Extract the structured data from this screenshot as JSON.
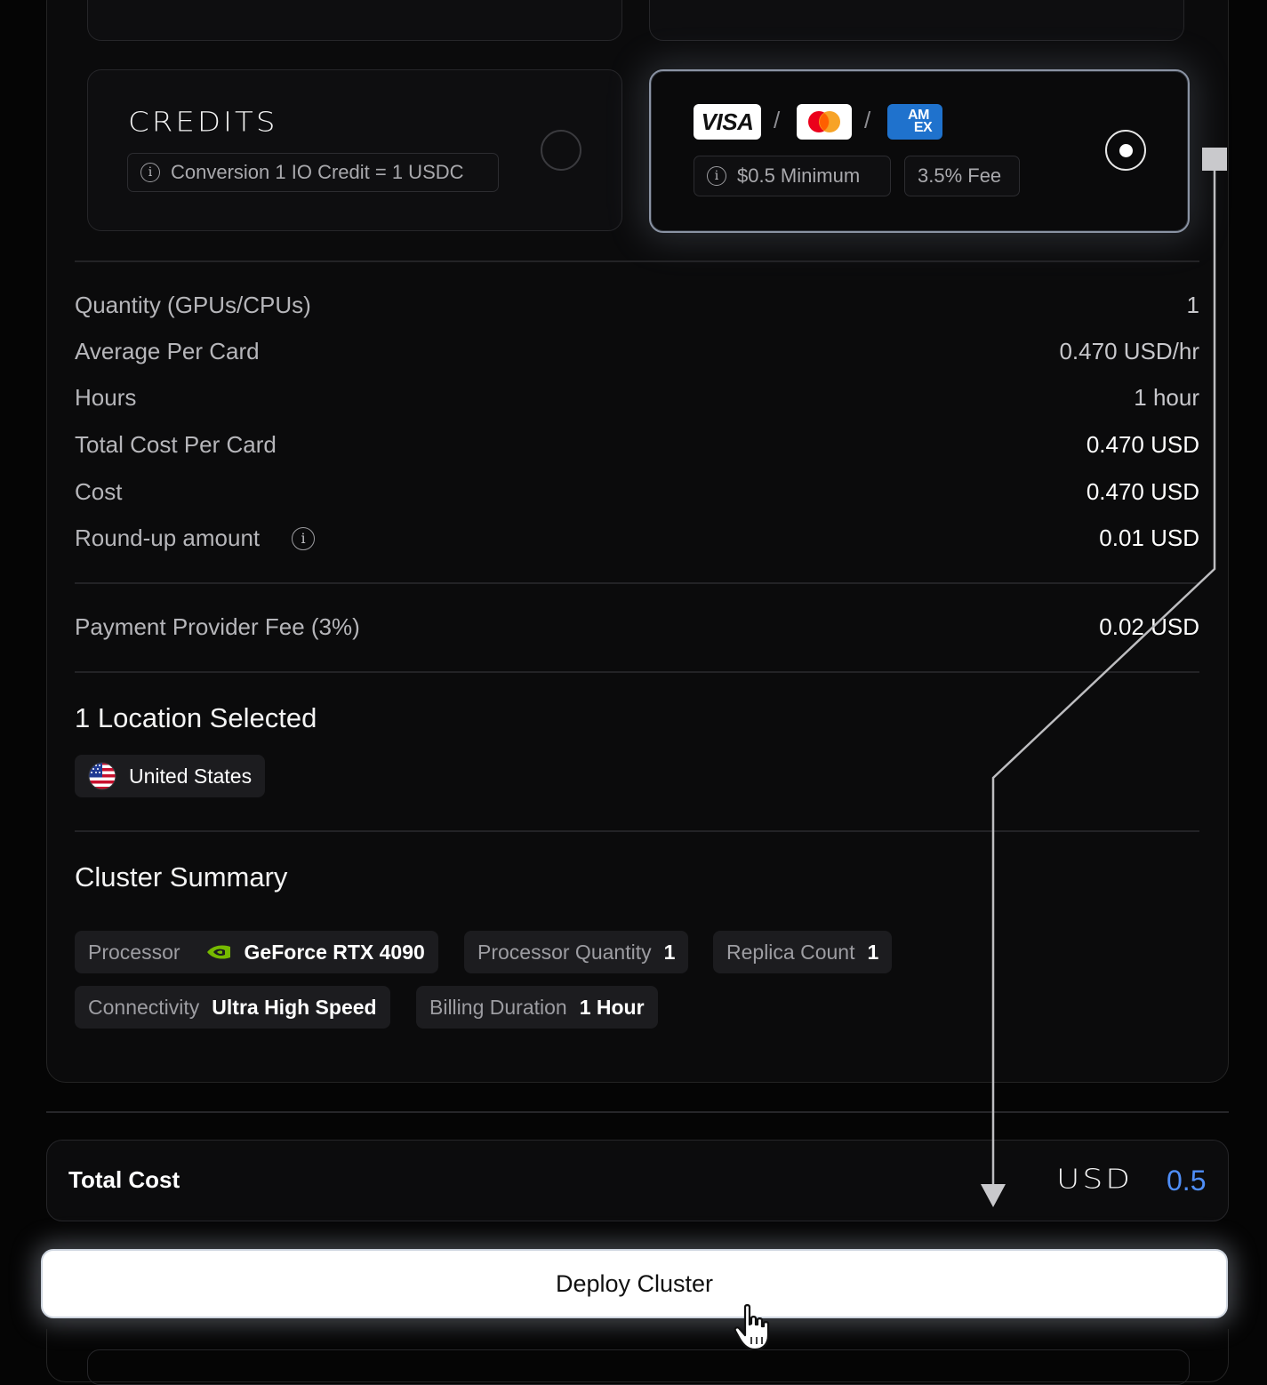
{
  "payment_options": {
    "credits": {
      "title": "CREDITS",
      "info_chip": "Conversion 1 IO Credit = 1 USDC",
      "selected": false
    },
    "cards": {
      "brands": [
        "VISA",
        "mastercard",
        "AMEX"
      ],
      "visa_label": "VISA",
      "amex_line1": "AM",
      "amex_line2": "EX",
      "separator": "/",
      "minimum_chip": "$0.5 Minimum",
      "fee_chip": "3.5% Fee",
      "selected": true
    }
  },
  "cost_rows": [
    {
      "label": "Quantity (GPUs/CPUs)",
      "value": "1"
    },
    {
      "label": "Average Per Card",
      "value": "0.470 USD/hr"
    },
    {
      "label": "Hours",
      "value": "1 hour"
    },
    {
      "label": "Total Cost Per Card",
      "value": "0.470 USD"
    },
    {
      "label": "Cost",
      "value": "0.470 USD"
    },
    {
      "label": "Round-up amount",
      "value": "0.01 USD"
    }
  ],
  "fee_row": {
    "label": "Payment Provider Fee (3%)",
    "value": "0.02 USD"
  },
  "locations": {
    "heading": "1 Location Selected",
    "items": [
      {
        "name": "United States",
        "flag": "us-flag-icon"
      }
    ]
  },
  "cluster_summary": {
    "heading": "Cluster Summary",
    "processor": {
      "key": "Processor",
      "value": "GeForce RTX 4090",
      "icon": "nvidia-icon"
    },
    "processor_quantity": {
      "key": "Processor Quantity",
      "value": "1"
    },
    "replica_count": {
      "key": "Replica Count",
      "value": "1"
    },
    "connectivity": {
      "key": "Connectivity",
      "value": "Ultra High Speed"
    },
    "billing_duration": {
      "key": "Billing Duration",
      "value": "1 Hour"
    }
  },
  "total": {
    "label": "Total Cost",
    "currency": "USD",
    "amount": "0.5",
    "amount_color": "#4f8ef7"
  },
  "deploy_button": {
    "label": "Deploy Cluster"
  },
  "colors": {
    "accent_blue": "#4f8ef7",
    "amex_blue": "#1f72cd",
    "nvidia_green": "#76b900"
  }
}
